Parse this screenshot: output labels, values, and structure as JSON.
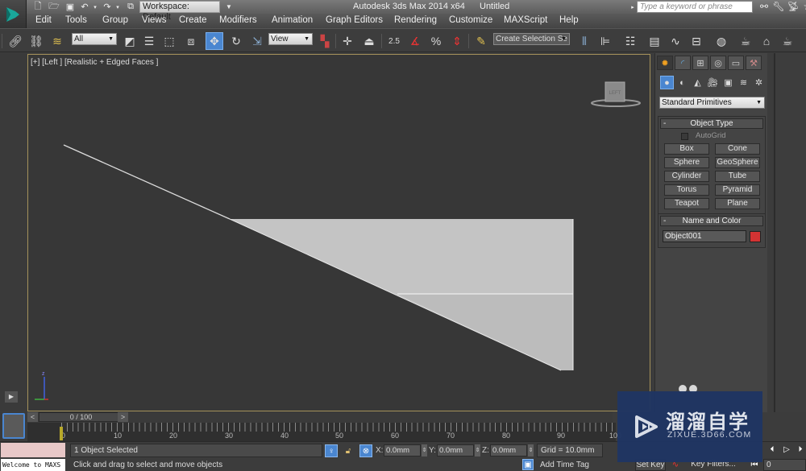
{
  "titlebar": {
    "workspace_label": "Workspace: Default",
    "app_title": "Autodesk 3ds Max  2014 x64",
    "doc_title": "Untitled",
    "search_placeholder": "Type a keyword or phrase",
    "icons": [
      "new-file-icon",
      "open-file-icon",
      "save-icon",
      "undo-icon",
      "redo-icon",
      "project-folder-icon",
      "binoculars-icon",
      "wrench-icon",
      "satellite-icon",
      "star-icon"
    ]
  },
  "menu": [
    "Edit",
    "Tools",
    "Group",
    "Views",
    "Create",
    "Modifiers",
    "Animation",
    "Graph Editors",
    "Rendering",
    "Customize",
    "MAXScript",
    "Help"
  ],
  "toolbar": {
    "selection_filter": "All",
    "reference_coord": "View",
    "named_selection": "Create Selection Se",
    "snap_label": "2.5"
  },
  "viewport": {
    "label": "[+] [Left ] [Realistic + Edged Faces ]",
    "viewcube_label": "LEFT",
    "axis_label": "z"
  },
  "command_panel": {
    "category": "Standard Primitives",
    "object_type_title": "Object Type",
    "autogrid_label": "AutoGrid",
    "autogrid_checked": false,
    "primitives": [
      "Box",
      "Cone",
      "Sphere",
      "GeoSphere",
      "Cylinder",
      "Tube",
      "Torus",
      "Pyramid",
      "Teapot",
      "Plane"
    ],
    "name_color_title": "Name and Color",
    "object_name": "Object001",
    "object_color": "#d33333"
  },
  "timeline": {
    "frame_display": "0 / 100",
    "prev": "<",
    "next": ">",
    "ticks": [
      "0",
      "10",
      "20",
      "30",
      "40",
      "50",
      "60",
      "70",
      "80",
      "90",
      "100"
    ]
  },
  "status": {
    "maxscript_text": "Welcome to MAXS",
    "selection_info": "1 Object Selected",
    "prompt": "Click and drag to select and move objects",
    "x_label": "X:",
    "x_value": "0.0mm",
    "y_label": "Y:",
    "y_value": "0.0mm",
    "z_label": "Z:",
    "z_value": "0.0mm",
    "grid": "Grid = 10.0mm",
    "add_time_tag": "Add Time Tag",
    "set_key": "Set Key",
    "key_filters": "Key Filters...",
    "current_frame": "0"
  },
  "watermark": {
    "title": "溜溜自学",
    "subtitle": "ZIXUE.3D66.COM"
  }
}
